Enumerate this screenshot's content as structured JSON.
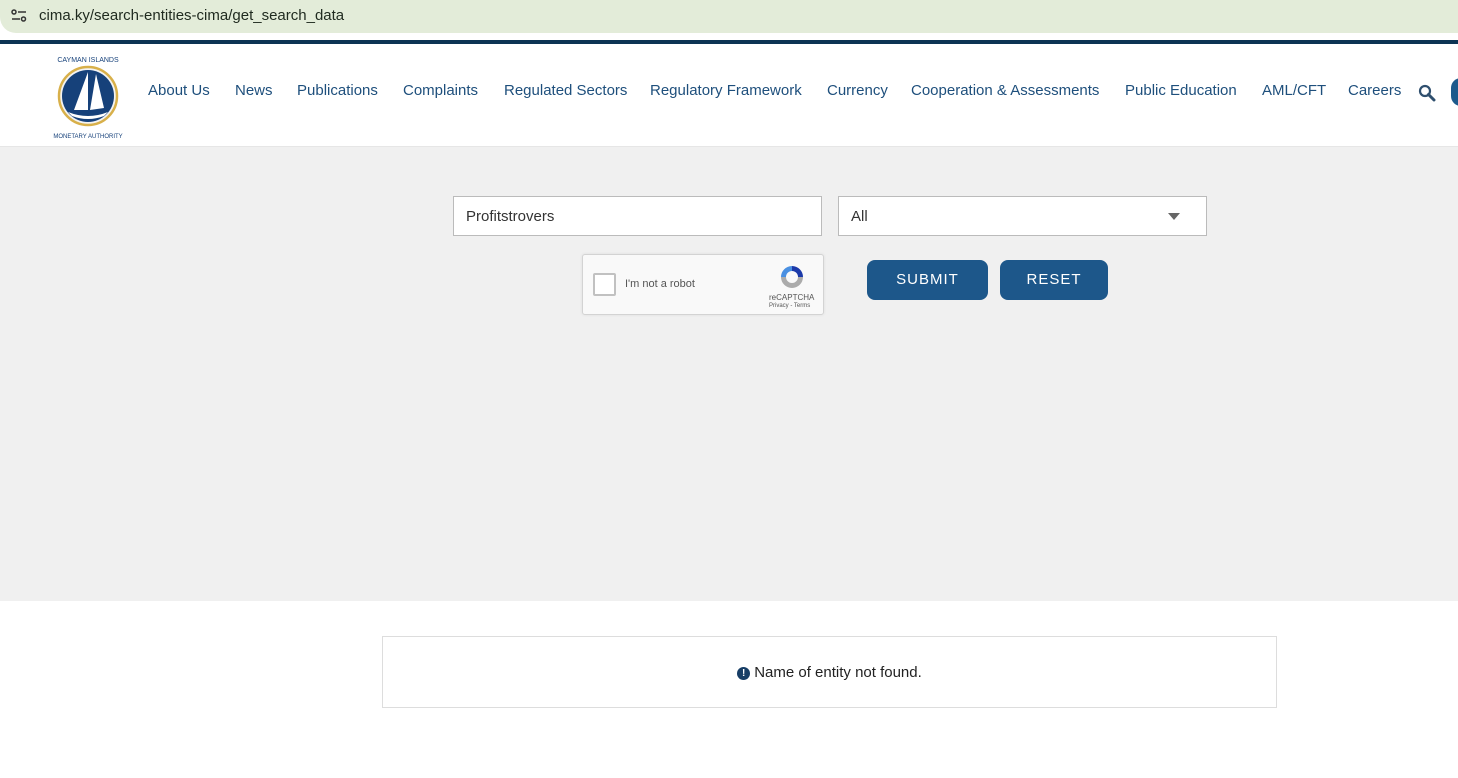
{
  "browser": {
    "url": "cima.ky/search-entities-cima/get_search_data"
  },
  "header": {
    "logo_text": "CAYMAN ISLANDS MONETARY AUTHORITY",
    "nav": [
      "About Us",
      "News",
      "Publications",
      "Complaints",
      "Regulated Sectors",
      "Regulatory Framework",
      "Currency",
      "Cooperation & Assessments",
      "Public Education",
      "AML/CFT",
      "Careers"
    ]
  },
  "search": {
    "query": "Profitstrovers",
    "category": "All",
    "captcha_label": "I'm not a robot",
    "captcha_brand": "reCAPTCHA",
    "captcha_terms": "Privacy - Terms",
    "submit": "SUBMIT",
    "reset": "RESET"
  },
  "result": {
    "message": "Name of entity not found.",
    "icon": "!"
  },
  "colors": {
    "brand": "#1d578a",
    "nav": "#1e4f7c",
    "topline": "#0d3454"
  }
}
